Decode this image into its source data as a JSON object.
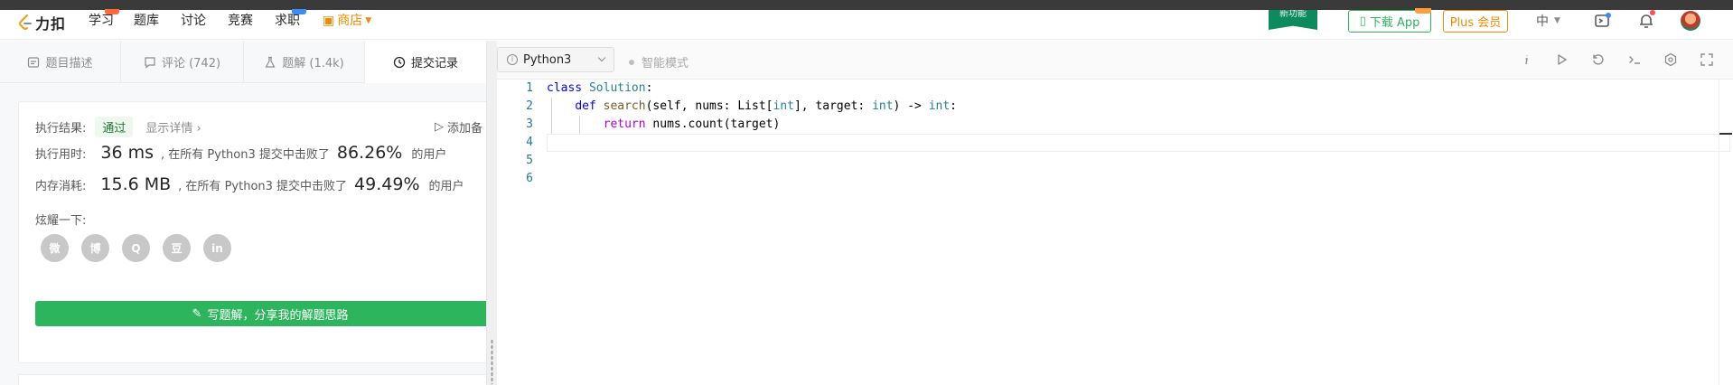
{
  "nav": {
    "logo_text": "力扣",
    "items": [
      "学习",
      "题库",
      "讨论",
      "竞赛",
      "求职"
    ],
    "store_label": "商店",
    "ribbon_text": "新功能",
    "download_app": "下载 App",
    "plus_member": "Plus 会员",
    "lang": "中"
  },
  "tabs": [
    {
      "label": "题目描述",
      "icon": "doc-icon"
    },
    {
      "label": "评论 (742)",
      "icon": "comment-icon"
    },
    {
      "label": "题解 (1.4k)",
      "icon": "flask-icon"
    },
    {
      "label": "提交记录",
      "icon": "clock-icon"
    }
  ],
  "result": {
    "status_label": "执行结果:",
    "status_value": "通过",
    "detail_link": "显示详情 ›",
    "add_note": "添加备",
    "runtime_label": "执行用时:",
    "runtime_value": "36 ms",
    "runtime_text": ", 在所有 Python3 提交中击败了",
    "runtime_pct": "86.26%",
    "runtime_suffix": "的用户",
    "memory_label": "内存消耗:",
    "memory_value": "15.6 MB",
    "memory_text": ", 在所有 Python3 提交中击败了",
    "memory_pct": "49.49%",
    "memory_suffix": "的用户",
    "share_label": "炫耀一下:",
    "share_icons": [
      "wechat-icon",
      "weibo-icon",
      "qq-icon",
      "douban-icon",
      "linkedin-icon"
    ],
    "share_glyphs": [
      "微",
      "博",
      "Q",
      "豆",
      "in"
    ],
    "write_button": "写题解，分享我的解题思路"
  },
  "editor": {
    "language": "Python3",
    "smart_mode": "智能模式",
    "line_numbers": [
      "1",
      "2",
      "3",
      "4",
      "5",
      "6"
    ],
    "code": {
      "l1_kw": "class",
      "l1_name": "Solution",
      "l1_colon": ":",
      "l2_kw": "def",
      "l2_fn": "search",
      "l2_a": "(self, nums: List[",
      "l2_t1": "int",
      "l2_b": "], target: ",
      "l2_t2": "int",
      "l2_c": ") -> ",
      "l2_t3": "int",
      "l2_d": ":",
      "l3_kw": "return",
      "l3_rest": "nums.count(target)"
    }
  },
  "colors": {
    "accent_green": "#2db55d",
    "store_orange": "#f08a00",
    "keyword_blue": "#0000ff",
    "type_teal": "#267f99"
  }
}
